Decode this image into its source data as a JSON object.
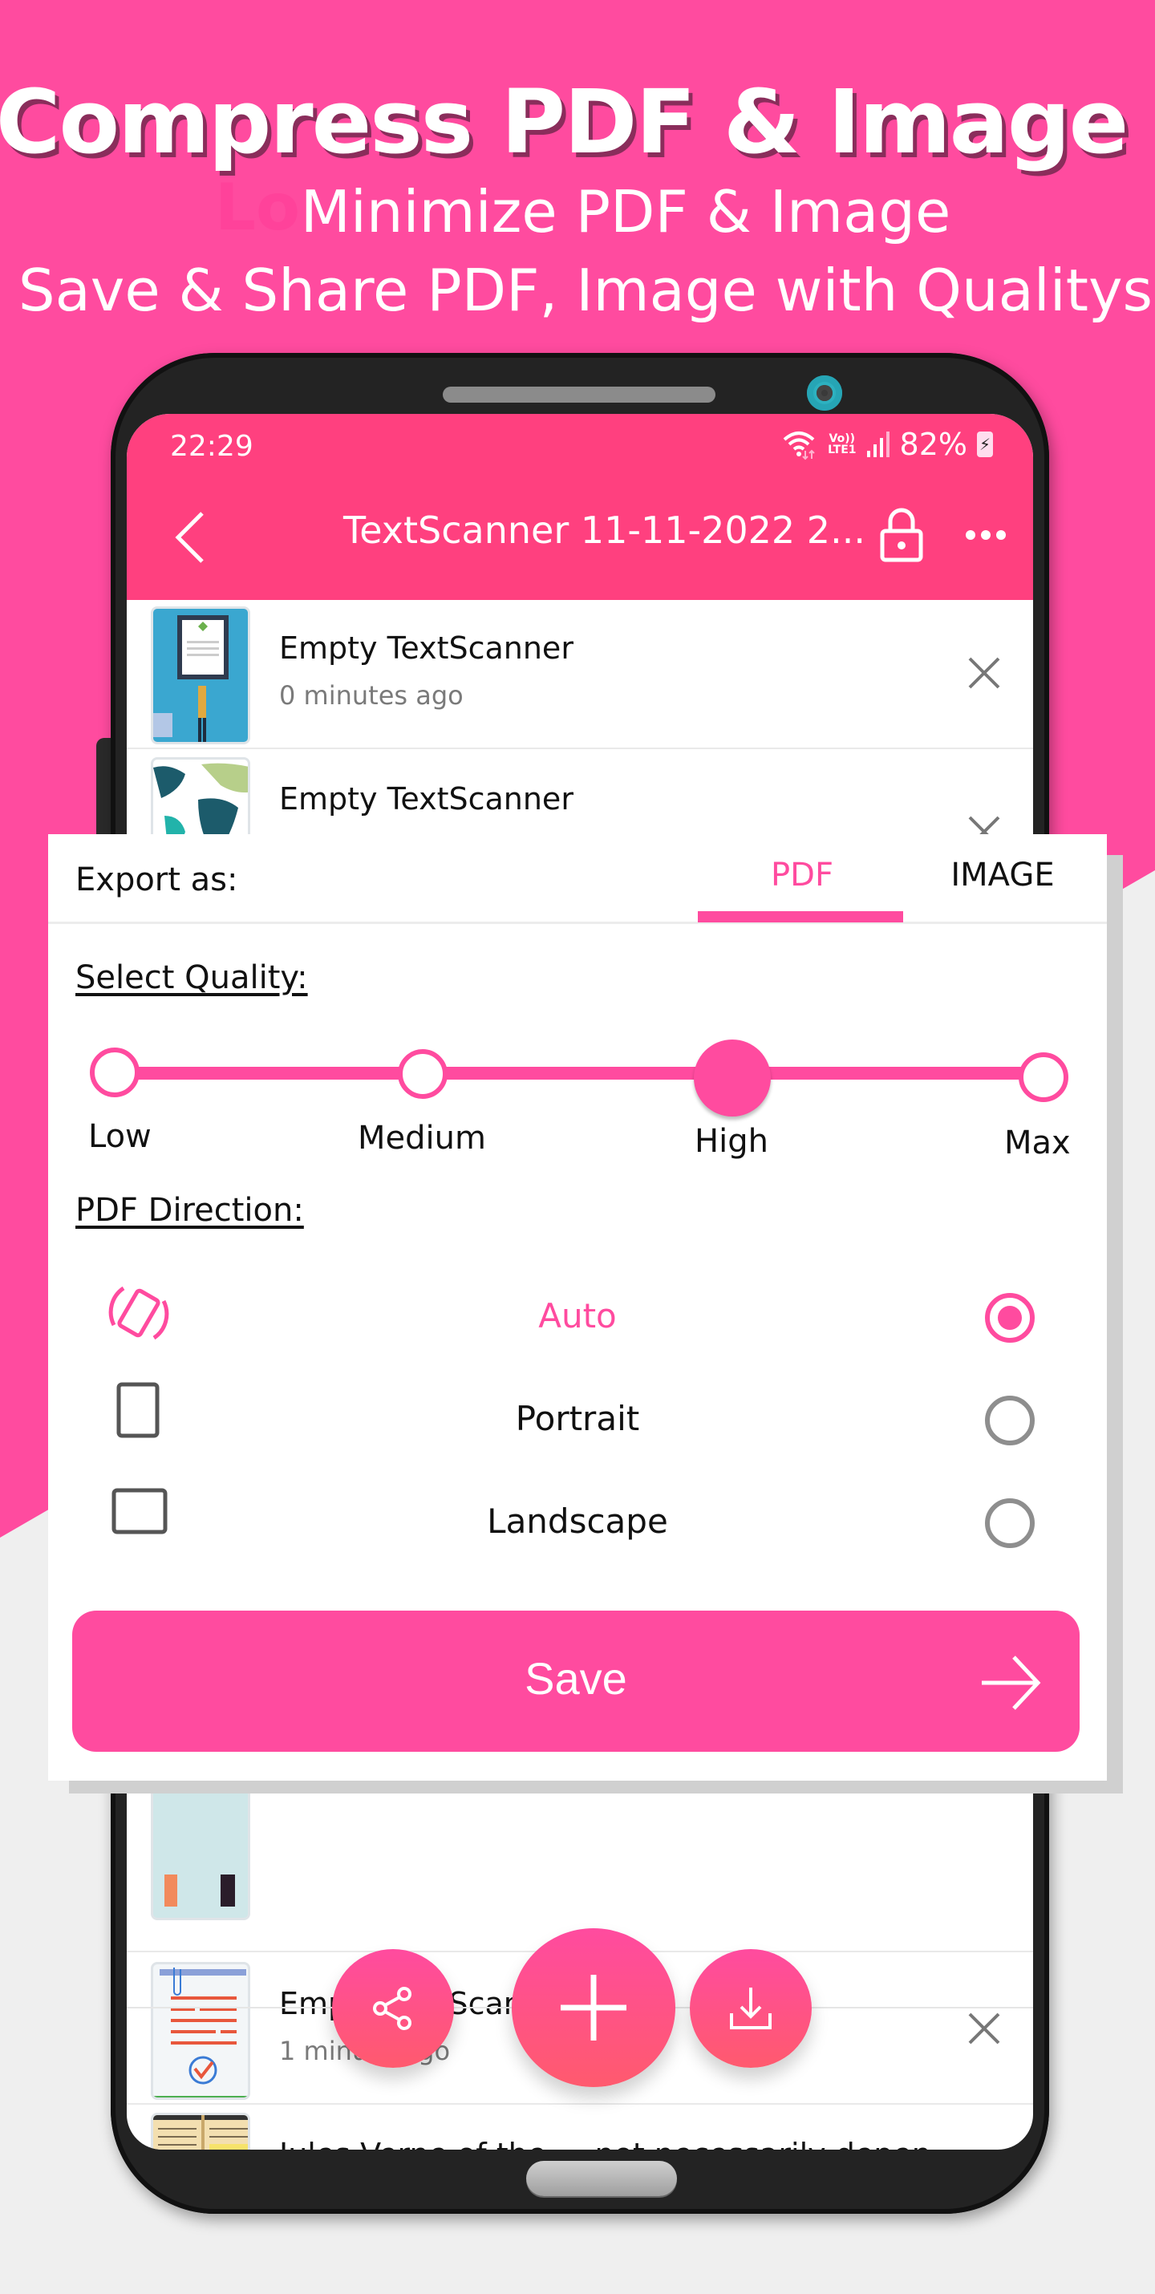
{
  "promo": {
    "headline": "Compress PDF & Image",
    "ghost_text": "Lo",
    "subline1": "Minimize PDF & Image",
    "subline2": "Save & Share PDF, Image with Qualitys"
  },
  "colors": {
    "brand_pink": "#ff4b9f",
    "appbar_pink": "#ff407f",
    "background_gray": "#efefef",
    "phone_frame": "#232323"
  },
  "status_bar": {
    "time": "22:29",
    "volte_top": "Vo))",
    "volte_bottom": "LTE1",
    "battery_percent": "82%",
    "icons": [
      "wifi-icon",
      "volte-icon",
      "signal-icon",
      "battery-charging-icon"
    ]
  },
  "toolbar": {
    "title": "TextScanner 11-11-2022 2...",
    "icons": [
      "back-icon",
      "lock-icon",
      "more-icon"
    ]
  },
  "list": {
    "items": [
      {
        "title": "Empty TextScanner",
        "subtitle": "0 minutes ago",
        "thumb": "tablet-reader-thumb"
      },
      {
        "title": "Empty TextScanner",
        "subtitle": "",
        "thumb": "world-map-thumb"
      },
      {
        "title": "",
        "subtitle": "",
        "thumb": "people-thumb"
      },
      {
        "title": "Empty TextScanner",
        "subtitle": "1 minute ago",
        "thumb": "checklist-thumb"
      },
      {
        "title": "Jules Verne of the ... not necessarily depend...",
        "visible_title": "Jules V... of the ... t nec... y depend...",
        "subtitle": "",
        "thumb": "open-book-thumb"
      }
    ]
  },
  "fabs": {
    "share": "share-icon",
    "add": "plus-icon",
    "download": "download-icon"
  },
  "export_dialog": {
    "label": "Export as:",
    "tabs": [
      {
        "label": "PDF",
        "selected": true
      },
      {
        "label": "IMAGE",
        "selected": false
      }
    ],
    "quality": {
      "label": "Select Quality:",
      "options": [
        "Low",
        "Medium",
        "High",
        "Max"
      ],
      "selected": "High",
      "selected_index": 2
    },
    "direction": {
      "label": "PDF Direction:",
      "options": [
        {
          "label": "Auto",
          "icon": "auto-rotate-icon",
          "selected": true
        },
        {
          "label": "Portrait",
          "icon": "portrait-icon",
          "selected": false
        },
        {
          "label": "Landscape",
          "icon": "landscape-icon",
          "selected": false
        }
      ]
    },
    "save_label": "Save"
  }
}
